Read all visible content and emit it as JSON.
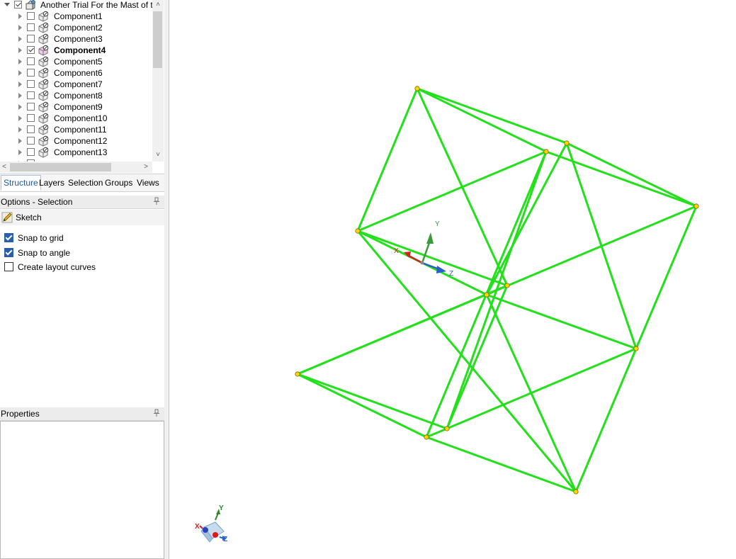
{
  "tree": {
    "root": {
      "label": "Another Trial For the Mast of the",
      "checked": true
    },
    "items": [
      {
        "label": "Component1",
        "checked": false,
        "bold": false
      },
      {
        "label": "Component2",
        "checked": false,
        "bold": false
      },
      {
        "label": "Component3",
        "checked": false,
        "bold": false
      },
      {
        "label": "Component4",
        "checked": true,
        "bold": true
      },
      {
        "label": "Component5",
        "checked": false,
        "bold": false
      },
      {
        "label": "Component6",
        "checked": false,
        "bold": false
      },
      {
        "label": "Component7",
        "checked": false,
        "bold": false
      },
      {
        "label": "Component8",
        "checked": false,
        "bold": false
      },
      {
        "label": "Component9",
        "checked": false,
        "bold": false
      },
      {
        "label": "Component10",
        "checked": false,
        "bold": false
      },
      {
        "label": "Component11",
        "checked": false,
        "bold": false
      },
      {
        "label": "Component12",
        "checked": false,
        "bold": false
      },
      {
        "label": "Component13",
        "checked": false,
        "bold": false
      }
    ]
  },
  "tabs": [
    {
      "label": "Structure",
      "active": true
    },
    {
      "label": "Layers",
      "active": false
    },
    {
      "label": "Selection",
      "active": false
    },
    {
      "label": "Groups",
      "active": false
    },
    {
      "label": "Views",
      "active": false
    }
  ],
  "options": {
    "title": "Options - Selection",
    "mode": "Sketch",
    "checkboxes": [
      {
        "label": "Snap to grid",
        "checked": true
      },
      {
        "label": "Snap to angle",
        "checked": true
      },
      {
        "label": "Create layout curves",
        "checked": false
      }
    ]
  },
  "properties": {
    "title": "Properties"
  },
  "viewport": {
    "line_color": "#22e01a",
    "vertex_color": "#ffd400",
    "axis_labels": {
      "x": "X",
      "y": "Y",
      "z": "Z"
    }
  },
  "colors": {
    "axis_x": "#d42020",
    "axis_y": "#3a9a3a",
    "axis_z": "#2a5fd0",
    "active_tab": "#1c5aa0"
  }
}
